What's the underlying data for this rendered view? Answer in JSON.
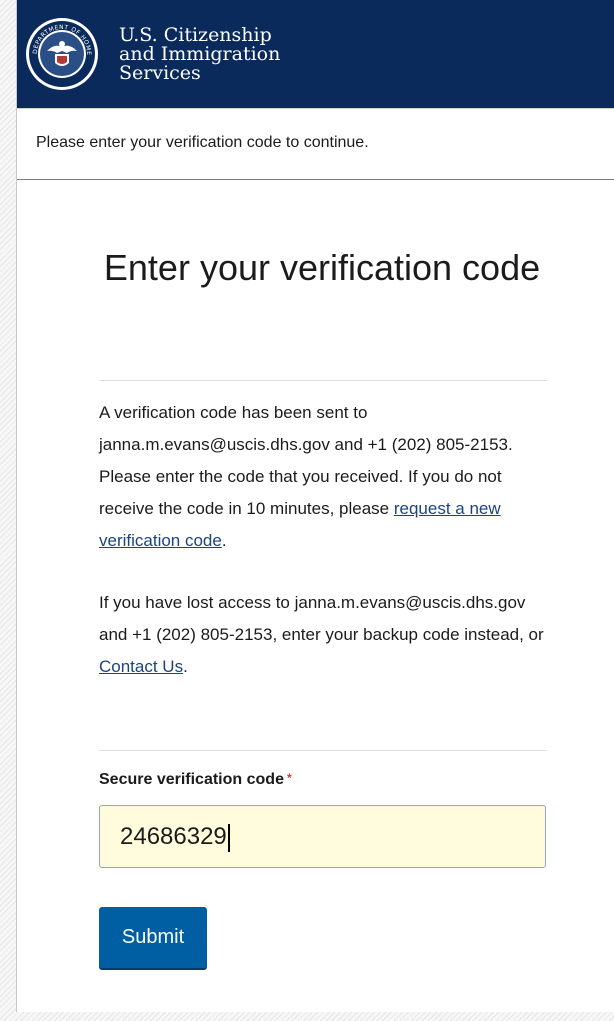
{
  "header": {
    "agency_line1": "U.S. Citizenship",
    "agency_line2": "and Immigration",
    "agency_line3": "Services",
    "seal_icon": "dhs-seal-icon",
    "seal_text": "DEPARTMENT OF HOMELAND SECURITY",
    "brand_color": "#0b2a5c"
  },
  "notice": {
    "text": "Please enter your verification code to continue."
  },
  "main": {
    "title": "Enter your verification code",
    "para1_text": "A verification code has been sent to janna.m.evans@uscis.dhs.gov and +1 (202) 805-2153. Please enter the code that you received. If you do not receive the code in 10 minutes, please ",
    "para1_link": "request a new verification code",
    "para1_end": ".",
    "para2_text": "If you have lost access to janna.m.evans@uscis.dhs.gov and +1 (202) 805-2153, enter your backup code instead, or ",
    "para2_link": "Contact Us",
    "para2_end": "."
  },
  "form": {
    "label": "Secure verification code",
    "required_mark": "*",
    "code_value": "24686329",
    "submit_label": "Submit",
    "button_color": "#005ea2"
  }
}
